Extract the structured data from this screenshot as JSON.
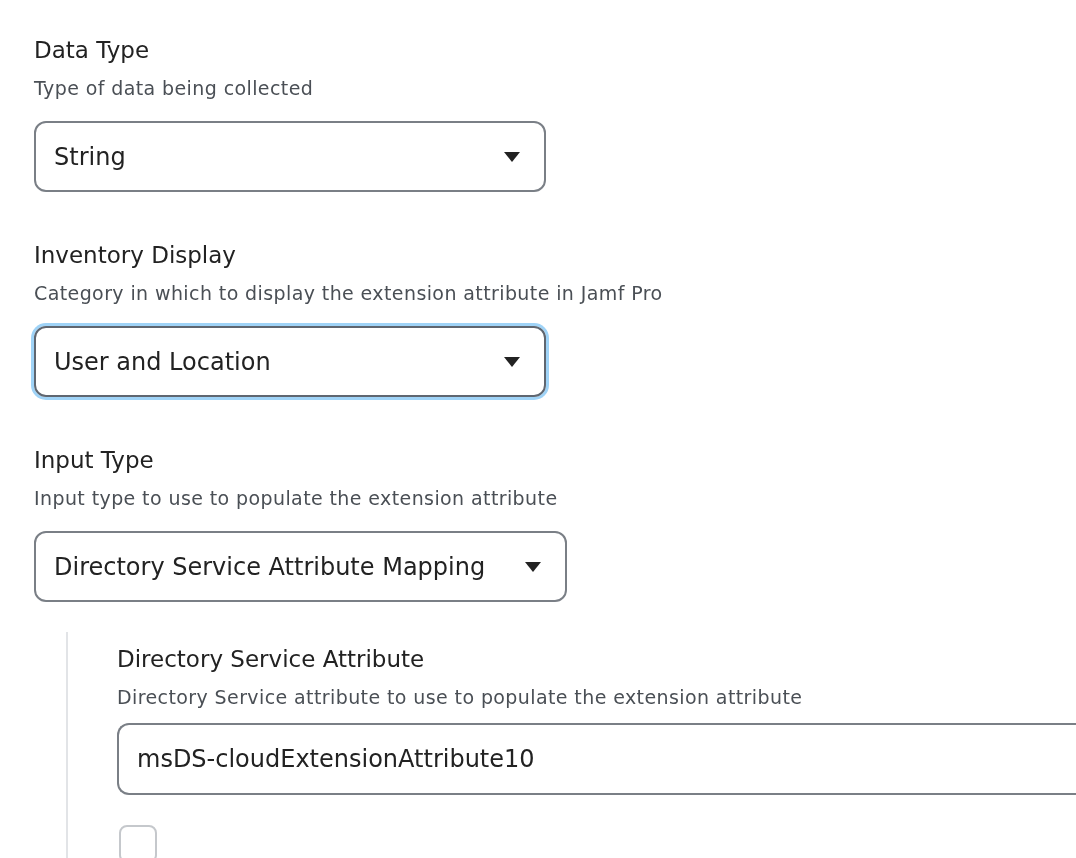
{
  "fields": [
    {
      "kind": "select",
      "label": "Data Type",
      "description": "Type of data being collected",
      "value": "String",
      "focused": false
    },
    {
      "kind": "select",
      "label": "Inventory Display",
      "description": "Category in which to display the extension attribute in Jamf Pro",
      "value": "User and Location",
      "focused": true
    },
    {
      "kind": "select",
      "label": "Input Type",
      "description": "Input type to use to populate the extension attribute",
      "value": "Directory Service Attribute Mapping",
      "focused": false
    }
  ],
  "nested": {
    "fields": [
      {
        "kind": "text",
        "label": "Directory Service Attribute",
        "description": "Directory Service attribute to use to populate the extension attribute",
        "value": "msDS-cloudExtensionAttribute10",
        "focused": false
      },
      {
        "kind": "checkbox",
        "checked": false
      }
    ]
  }
}
